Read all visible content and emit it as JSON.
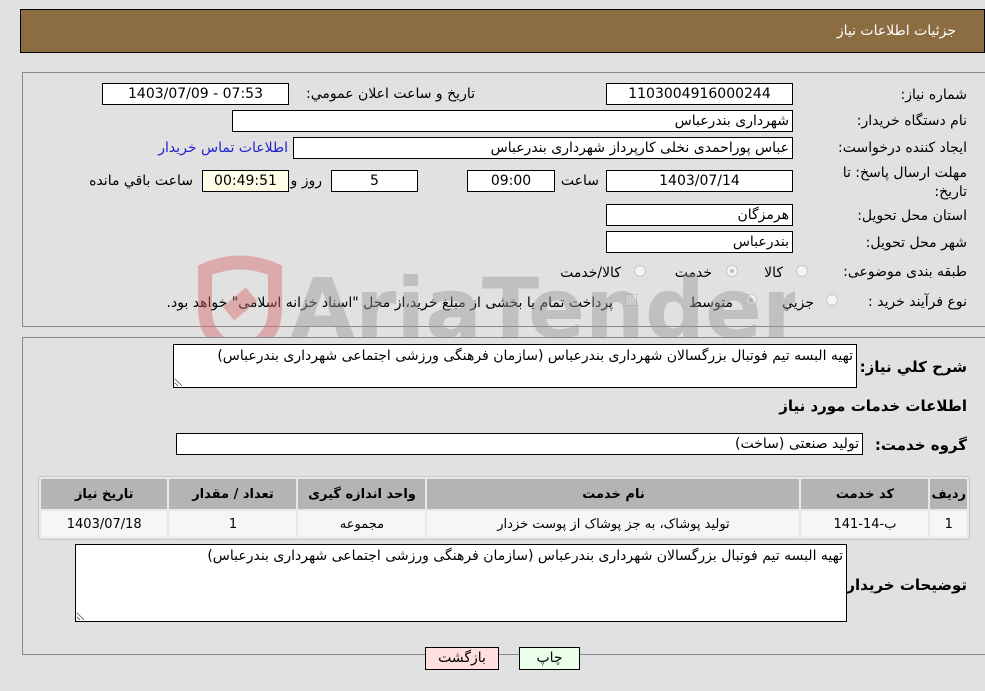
{
  "header": {
    "title": "جزئیات اطلاعات نیاز"
  },
  "form": {
    "need_number": {
      "label": "شماره نیاز:",
      "value": "1103004916000244"
    },
    "announce": {
      "label": "تاریخ و ساعت اعلان عمومي:",
      "value": "1403/07/09 - 07:53"
    },
    "buyer_org": {
      "label": "نام دستگاه خريدار:",
      "value": "شهرداری بندرعباس"
    },
    "requester": {
      "label": "ايجاد كننده درخواست:",
      "value": "عباس پوراحمدی نخلی کارپرداز شهرداری بندرعباس"
    },
    "contact_link": "اطلاعات تماس خريدار",
    "deadline": {
      "label_line1": "مهلت ارسال پاسخ: تا",
      "label_line2": "تاريخ:",
      "date": "1403/07/14",
      "time_label": "ساعت",
      "time": "09:00",
      "days": "5",
      "days_label": "روز و",
      "remaining": "00:49:51",
      "remaining_label": "ساعت باقي مانده"
    },
    "province": {
      "label": "استان محل تحويل:",
      "value": "هرمزگان"
    },
    "city": {
      "label": "شهر محل تحويل:",
      "value": "بندرعباس"
    },
    "category": {
      "label": "طبقه بندی موضوعی:",
      "options": [
        "کالا",
        "خدمت",
        "کالا/خدمت"
      ],
      "selected": "خدمت"
    },
    "process": {
      "label": "نوع فرآيند خريد :",
      "options": [
        "جزيي",
        "متوسط"
      ],
      "selected": "متوسط",
      "treasury_note": "پرداخت تمام يا بخشی از مبلغ خريد،از محل \"اسناد خزانه اسلامی\" خواهد بود."
    }
  },
  "description": {
    "label": "شرح كلي نياز:",
    "value": "تهيه البسه تيم فوتبال بزرگسالان شهرداری بندرعباس (سازمان فرهنگی ورزشی اجتماعی شهرداری بندرعباس)"
  },
  "services_section": {
    "title": "اطلاعات خدمات مورد نياز",
    "group_label": "گروه خدمت:",
    "group_value": "تولید صنعتی (ساخت)"
  },
  "table": {
    "headers": [
      "رديف",
      "كد خدمت",
      "نام خدمت",
      "واحد اندازه گيری",
      "تعداد / مقدار",
      "تاريخ نياز"
    ],
    "rows": [
      [
        "1",
        "ب-14-141",
        "تولید پوشاک، به جز پوشاک از پوست خزدار",
        "مجموعه",
        "1",
        "1403/07/18"
      ]
    ]
  },
  "buyer_notes": {
    "label": "توضيحات خريدار:",
    "value": "تهيه البسه تيم فوتبال بزرگسالان شهرداری بندرعباس (سازمان فرهنگی ورزشی اجتماعی شهرداری بندرعباس)"
  },
  "buttons": {
    "print": "چاپ",
    "back": "بازگشت"
  },
  "watermark": {
    "text": "AriaTender.neT"
  },
  "colors": {
    "header_bg": "#8c6d42",
    "print_bg": "#eaffea",
    "back_bg": "#ffdede",
    "remaining_bg": "#fdfde8",
    "link": "#2222cc"
  }
}
